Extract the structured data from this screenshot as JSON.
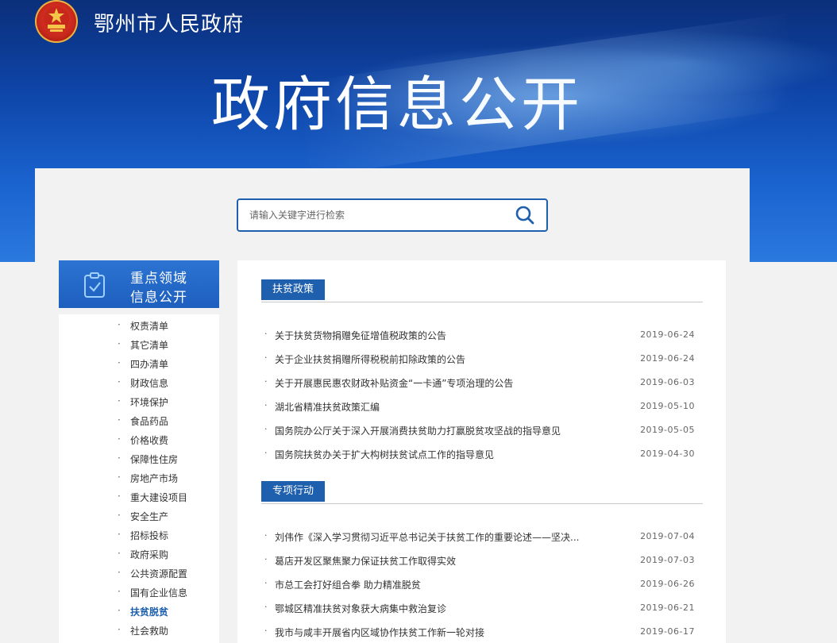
{
  "site": {
    "name": "鄂州市人民政府"
  },
  "banner": {
    "title": "政府信息公开"
  },
  "search": {
    "placeholder": "请输入关键字进行检索"
  },
  "sidebar": {
    "heading_line1": "重点领域",
    "heading_line2": "信息公开",
    "items": [
      {
        "label": "权责清单"
      },
      {
        "label": "其它清单"
      },
      {
        "label": "四办清单"
      },
      {
        "label": "财政信息"
      },
      {
        "label": "环境保护"
      },
      {
        "label": "食品药品"
      },
      {
        "label": "价格收费"
      },
      {
        "label": "保障性住房"
      },
      {
        "label": "房地产市场"
      },
      {
        "label": "重大建设项目"
      },
      {
        "label": "安全生产"
      },
      {
        "label": "招标投标"
      },
      {
        "label": "政府采购"
      },
      {
        "label": "公共资源配置"
      },
      {
        "label": "国有企业信息"
      },
      {
        "label": "扶贫脱贫",
        "active": true
      },
      {
        "label": "社会救助"
      }
    ]
  },
  "sections": [
    {
      "title": "扶贫政策",
      "items": [
        {
          "title": "关于扶贫货物捐赠免征增值税政策的公告",
          "date": "2019-06-24"
        },
        {
          "title": "关于企业扶贫捐赠所得税税前扣除政策的公告",
          "date": "2019-06-24"
        },
        {
          "title": "关于开展惠民惠农财政补贴资金“一卡通”专项治理的公告",
          "date": "2019-06-03"
        },
        {
          "title": "湖北省精准扶贫政策汇编",
          "date": "2019-05-10"
        },
        {
          "title": "国务院办公厅关于深入开展消费扶贫助力打赢脱贫攻坚战的指导意见",
          "date": "2019-05-05"
        },
        {
          "title": "国务院扶贫办关于扩大构树扶贫试点工作的指导意见",
          "date": "2019-04-30"
        }
      ]
    },
    {
      "title": "专项行动",
      "items": [
        {
          "title": "刘伟作《深入学习贯彻习近平总书记关于扶贫工作的重要论述——坚决...",
          "date": "2019-07-04"
        },
        {
          "title": "葛店开发区聚焦聚力保证扶贫工作取得实效",
          "date": "2019-07-03"
        },
        {
          "title": "市总工会打好组合拳 助力精准脱贫",
          "date": "2019-06-26"
        },
        {
          "title": "鄂城区精准扶贫对象获大病集中救治复诊",
          "date": "2019-06-21"
        },
        {
          "title": "我市与咸丰开展省内区域协作扶贫工作新一轮对接",
          "date": "2019-06-17"
        }
      ]
    }
  ]
}
